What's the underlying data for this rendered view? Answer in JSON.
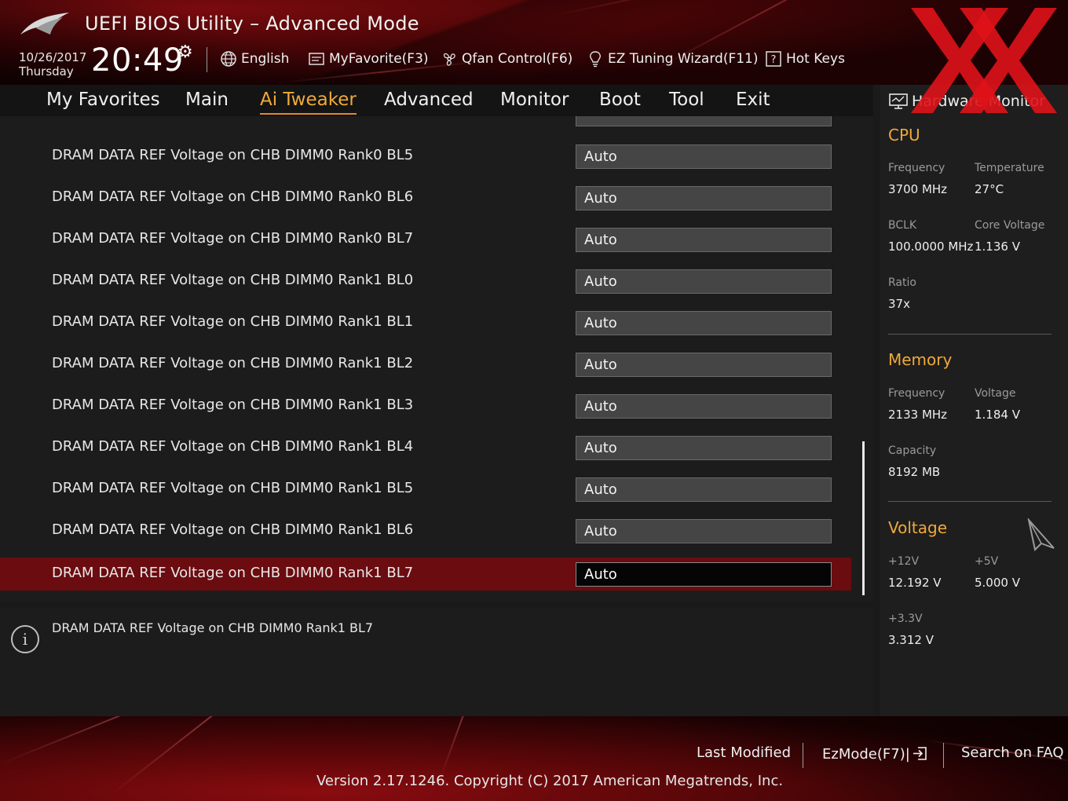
{
  "header": {
    "title": "UEFI BIOS Utility – Advanced Mode",
    "date": "10/26/2017",
    "day": "Thursday",
    "time": "20:49",
    "toolbar": {
      "language": "English",
      "my_favorite": "MyFavorite(F3)",
      "qfan": "Qfan Control(F6)",
      "ez_tuning": "EZ Tuning Wizard(F11)",
      "hot_keys": "Hot Keys"
    }
  },
  "nav": {
    "tabs": [
      {
        "label": "My Favorites"
      },
      {
        "label": "Main"
      },
      {
        "label": "Ai Tweaker"
      },
      {
        "label": "Advanced"
      },
      {
        "label": "Monitor"
      },
      {
        "label": "Boot"
      },
      {
        "label": "Tool"
      },
      {
        "label": "Exit"
      }
    ],
    "active": "Ai Tweaker"
  },
  "settings": [
    {
      "label": "DRAM DATA REF Voltage on CHB DIMM0 Rank0 BL5",
      "value": "Auto"
    },
    {
      "label": "DRAM DATA REF Voltage on CHB DIMM0 Rank0 BL6",
      "value": "Auto"
    },
    {
      "label": "DRAM DATA REF Voltage on CHB DIMM0 Rank0 BL7",
      "value": "Auto"
    },
    {
      "label": "DRAM DATA REF Voltage on CHB DIMM0 Rank1 BL0",
      "value": "Auto"
    },
    {
      "label": "DRAM DATA REF Voltage on CHB DIMM0 Rank1 BL1",
      "value": "Auto"
    },
    {
      "label": "DRAM DATA REF Voltage on CHB DIMM0 Rank1 BL2",
      "value": "Auto"
    },
    {
      "label": "DRAM DATA REF Voltage on CHB DIMM0 Rank1 BL3",
      "value": "Auto"
    },
    {
      "label": "DRAM DATA REF Voltage on CHB DIMM0 Rank1 BL4",
      "value": "Auto"
    },
    {
      "label": "DRAM DATA REF Voltage on CHB DIMM0 Rank1 BL5",
      "value": "Auto"
    },
    {
      "label": "DRAM DATA REF Voltage on CHB DIMM0 Rank1 BL6",
      "value": "Auto"
    },
    {
      "label": "DRAM DATA REF Voltage on CHB DIMM0 Rank1 BL7",
      "value": "Auto"
    }
  ],
  "selected_setting": "DRAM DATA REF Voltage on CHB DIMM0 Rank1 BL7",
  "description": "DRAM DATA REF Voltage on CHB DIMM0 Rank1 BL7",
  "hardware_monitor": {
    "title": "Hardware Monitor",
    "cpu": {
      "title": "CPU",
      "frequency_label": "Frequency",
      "frequency": "3700 MHz",
      "temperature_label": "Temperature",
      "temperature": "27°C",
      "bclk_label": "BCLK",
      "bclk": "100.0000 MHz",
      "core_voltage_label": "Core Voltage",
      "core_voltage": "1.136 V",
      "ratio_label": "Ratio",
      "ratio": "37x"
    },
    "memory": {
      "title": "Memory",
      "frequency_label": "Frequency",
      "frequency": "2133 MHz",
      "voltage_label": "Voltage",
      "voltage": "1.184 V",
      "capacity_label": "Capacity",
      "capacity": "8192 MB"
    },
    "voltage": {
      "title": "Voltage",
      "v12_label": "+12V",
      "v12": "12.192 V",
      "v5_label": "+5V",
      "v5": "5.000 V",
      "v33_label": "+3.3V",
      "v33": "3.312 V"
    }
  },
  "footer": {
    "last_modified": "Last Modified",
    "ezmode": "EzMode(F7)|",
    "search_faq": "Search on FAQ",
    "version": "Version 2.17.1246. Copyright (C) 2017 American Megatrends, Inc."
  },
  "colors": {
    "accent": "#f0a93a",
    "selected_row": "#6b0c10",
    "brand_red": "#c8161d",
    "watermark_red": "#e0121a"
  },
  "icons": [
    "rog-logo-icon",
    "gear-icon",
    "globe-icon",
    "favorite-icon",
    "fan-icon",
    "bulb-icon",
    "help-icon",
    "monitor-icon",
    "info-icon",
    "exit-arrow-icon",
    "mouse-cursor-icon",
    "watermark-x-logo"
  ]
}
